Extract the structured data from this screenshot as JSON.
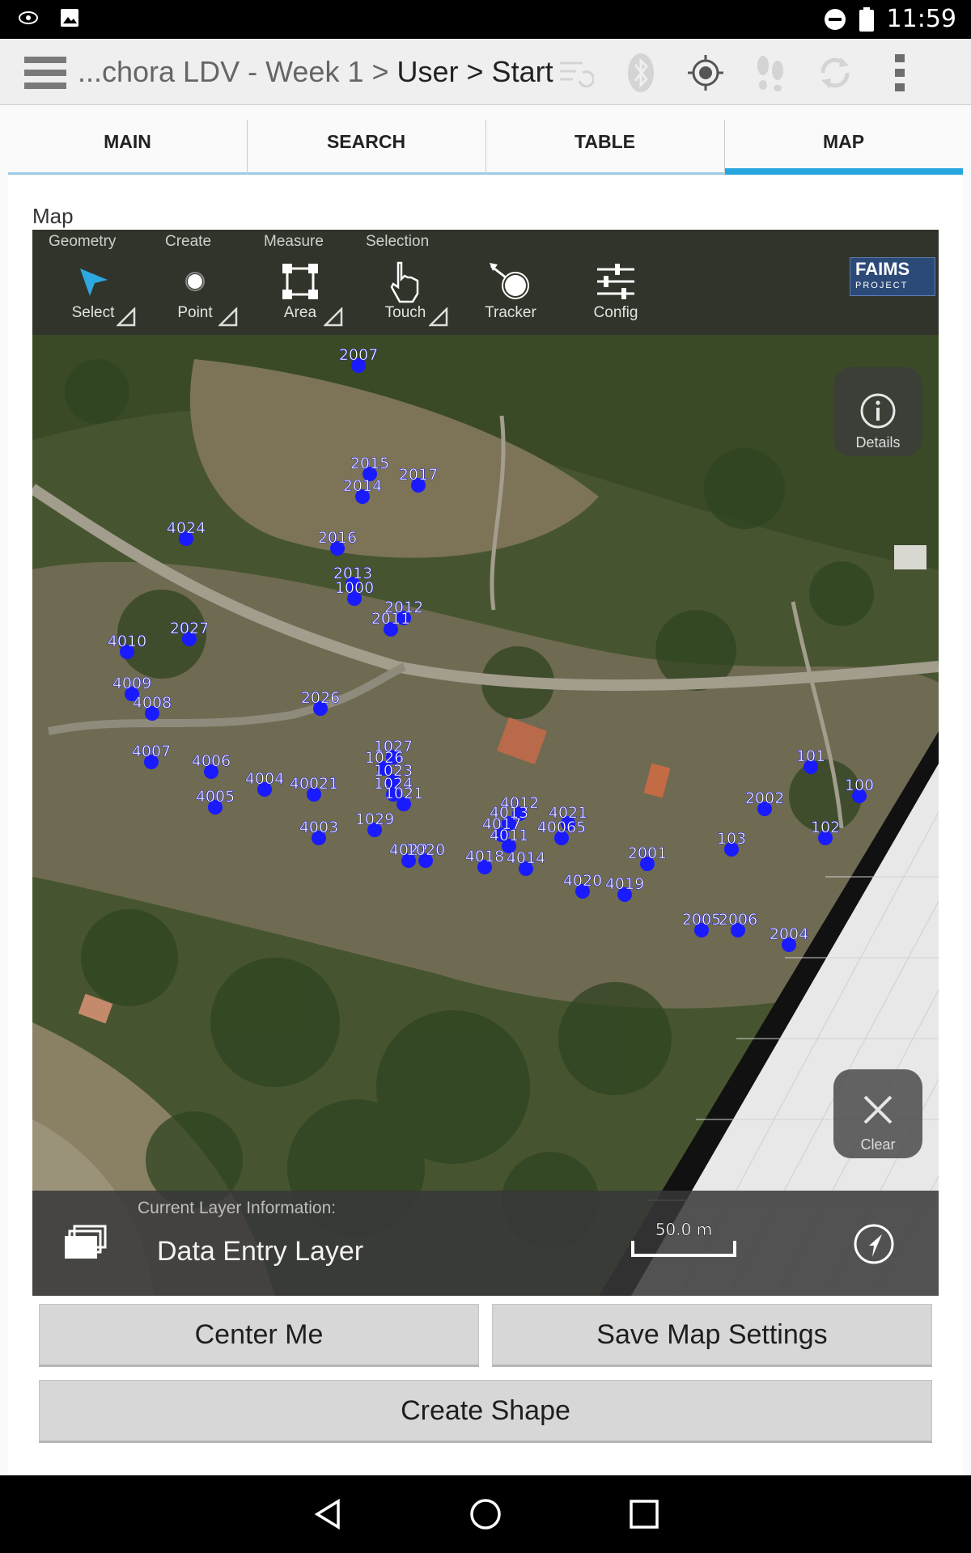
{
  "status_bar": {
    "time": "11:59"
  },
  "action_bar": {
    "breadcrumb_prefix": "...chora LDV - Week 1 > ",
    "breadcrumb_current": "User > Start"
  },
  "tabs": [
    {
      "label": "MAIN",
      "active": false
    },
    {
      "label": "SEARCH",
      "active": false
    },
    {
      "label": "TABLE",
      "active": false
    },
    {
      "label": "MAP",
      "active": true
    }
  ],
  "map": {
    "section_label": "Map",
    "toolbar": {
      "groups": [
        "Geometry",
        "Create",
        "Measure",
        "Selection"
      ],
      "buttons": [
        "Select",
        "Point",
        "Area",
        "Touch",
        "Tracker",
        "Config"
      ]
    },
    "logo": {
      "line1": "FAIMS",
      "line2": "PROJECT"
    },
    "details_label": "Details",
    "clear_label": "Clear",
    "layer_caption": "Current Layer Information:",
    "layer_name": "Data Entry Layer",
    "scale_label": "50.0 m",
    "points": [
      {
        "label": "2007"
      },
      {
        "label": "2015"
      },
      {
        "label": "2017"
      },
      {
        "label": "2014"
      },
      {
        "label": "4024"
      },
      {
        "label": "2016"
      },
      {
        "label": "2013"
      },
      {
        "label": "1000"
      },
      {
        "label": "2012"
      },
      {
        "label": "2011"
      },
      {
        "label": "4010"
      },
      {
        "label": "2027"
      },
      {
        "label": "4009"
      },
      {
        "label": "4008"
      },
      {
        "label": "2026"
      },
      {
        "label": "4007"
      },
      {
        "label": "4006"
      },
      {
        "label": "4004"
      },
      {
        "label": "40021"
      },
      {
        "label": "4005"
      },
      {
        "label": "4003"
      },
      {
        "label": "1027"
      },
      {
        "label": "1026"
      },
      {
        "label": "1023"
      },
      {
        "label": "1024"
      },
      {
        "label": "1021"
      },
      {
        "label": "1029"
      },
      {
        "label": "4022"
      },
      {
        "label": "1020"
      },
      {
        "label": "4012"
      },
      {
        "label": "4013"
      },
      {
        "label": "4017"
      },
      {
        "label": "4011"
      },
      {
        "label": "4021"
      },
      {
        "label": "40065"
      },
      {
        "label": "4018"
      },
      {
        "label": "4014"
      },
      {
        "label": "4020"
      },
      {
        "label": "4019"
      },
      {
        "label": "2001"
      },
      {
        "label": "103"
      },
      {
        "label": "2002"
      },
      {
        "label": "101"
      },
      {
        "label": "100"
      },
      {
        "label": "102"
      },
      {
        "label": "2005"
      },
      {
        "label": "2006"
      },
      {
        "label": "2004"
      }
    ]
  },
  "buttons": {
    "center_me": "Center Me",
    "save_map_settings": "Save Map Settings",
    "create_shape": "Create Shape"
  }
}
